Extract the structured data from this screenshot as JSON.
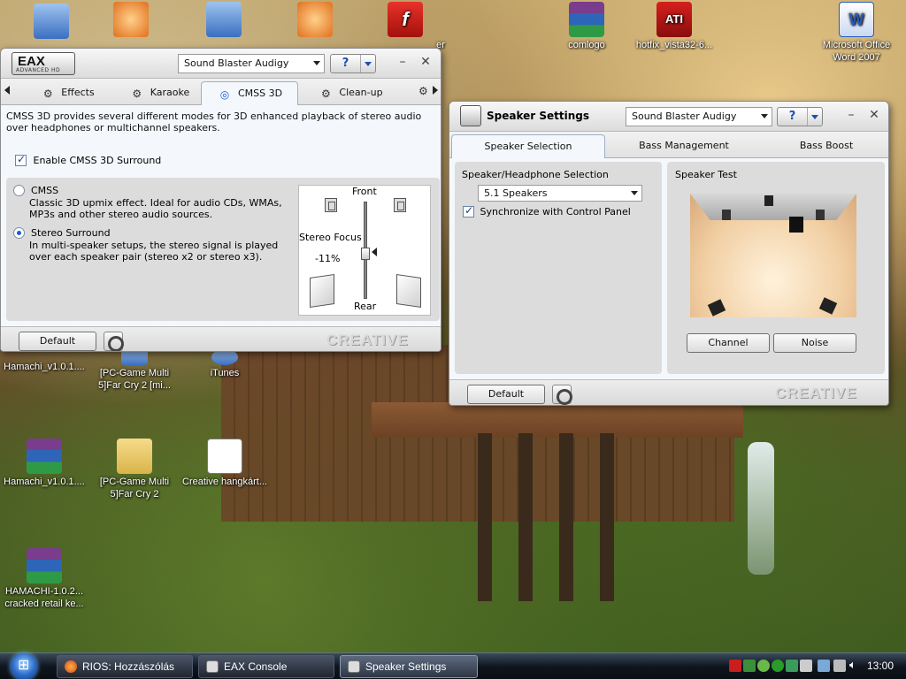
{
  "desktop": {
    "icons": [
      {
        "label": "comlogo",
        "kind": "winrar"
      },
      {
        "label": "hotfix_vista32-6...",
        "kind": "ati"
      },
      {
        "label": "Microsoft Office Word 2007",
        "kind": "word"
      },
      {
        "label": "Hamachi_v1.0.1....",
        "kind": "gen"
      },
      {
        "label": "[PC-Game Multi 5]Far Cry 2 [mi...",
        "kind": "gen"
      },
      {
        "label": "iTunes",
        "kind": "gen"
      },
      {
        "label": "Hamachi_v1.0.1....",
        "kind": "winrar"
      },
      {
        "label": "[PC-Game Multi 5]Far Cry 2",
        "kind": "folder"
      },
      {
        "label": "Creative hangkárt...",
        "kind": "doc"
      },
      {
        "label": "HAMACHI-1.0.2... cracked retail ke...",
        "kind": "winrar"
      },
      {
        "label": "er",
        "kind": "partial"
      }
    ]
  },
  "eax": {
    "logo": "EAX",
    "logo_sub": "ADVANCED HD",
    "device": "Sound Blaster Audigy",
    "help": "?",
    "tabs": [
      "Effects",
      "Karaoke",
      "CMSS 3D",
      "Clean-up"
    ],
    "active_tab": "CMSS 3D",
    "description": "CMSS 3D provides several different modes for 3D enhanced playback of stereo audio over headphones or multichannel speakers.",
    "enable_label": "Enable CMSS 3D Surround",
    "enable_checked": true,
    "options": [
      {
        "title": "CMSS",
        "desc": "Classic 3D upmix effect.  Ideal for audio CDs, WMAs, MP3s and other stereo audio sources.",
        "selected": false
      },
      {
        "title": "Stereo Surround",
        "desc": "In multi-speaker setups, the stereo signal is played over each speaker pair (stereo x2 or stereo x3).",
        "selected": true
      }
    ],
    "focus": {
      "front": "Front",
      "rear": "Rear",
      "label": "Stereo Focus",
      "value": "-11%"
    },
    "default_btn": "Default",
    "brand": "CREATIVE"
  },
  "speaker": {
    "title": "Speaker Settings",
    "device": "Sound Blaster Audigy",
    "help": "?",
    "tabs": [
      "Speaker Selection",
      "Bass Management",
      "Bass Boost"
    ],
    "active_tab": "Speaker Selection",
    "selection_heading": "Speaker/Headphone Selection",
    "selection_value": "5.1 Speakers",
    "sync_label": "Synchronize with Control Panel",
    "sync_checked": true,
    "test_heading": "Speaker Test",
    "channel_btn": "Channel",
    "noise_btn": "Noise",
    "default_btn": "Default",
    "brand": "CREATIVE"
  },
  "taskbar": {
    "buttons": [
      {
        "label": "RIOS: Hozzászólás ír...",
        "active": false
      },
      {
        "label": "EAX Console",
        "active": false
      },
      {
        "label": "Speaker Settings",
        "active": true
      }
    ],
    "clock": "13:00"
  },
  "colors": {
    "accent": "#1e5ad1",
    "brand_text": "#d8d8d8"
  }
}
